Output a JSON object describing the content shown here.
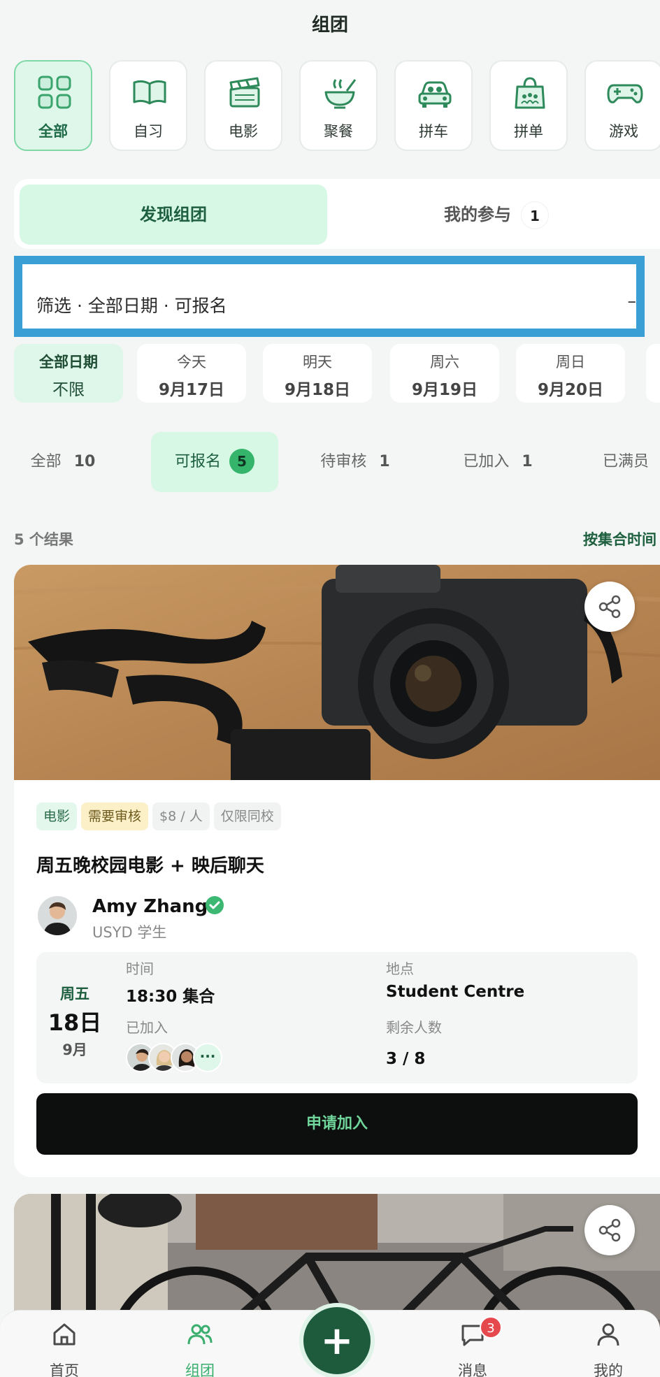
{
  "header": {
    "title": "组团"
  },
  "categories": [
    {
      "label": "全部",
      "icon": "grid-icon",
      "active": true
    },
    {
      "label": "自习",
      "icon": "book-icon"
    },
    {
      "label": "电影",
      "icon": "clapperboard-icon"
    },
    {
      "label": "聚餐",
      "icon": "bowl-icon"
    },
    {
      "label": "拼车",
      "icon": "car-icon"
    },
    {
      "label": "拼单",
      "icon": "shopping-bag-icon"
    },
    {
      "label": "游戏",
      "icon": "gamepad-icon"
    }
  ],
  "segments": {
    "discover": "发现组团",
    "mine": "我的参与",
    "mine_count": "1"
  },
  "filter": {
    "summary": "筛选 · 全部日期 · 可报名",
    "trailing": "–"
  },
  "dates": [
    {
      "top": "全部日期",
      "bottom": "不限",
      "active": true
    },
    {
      "top": "今天",
      "bottom": "9月17日"
    },
    {
      "top": "明天",
      "bottom": "9月18日"
    },
    {
      "top": "周六",
      "bottom": "9月19日"
    },
    {
      "top": "周日",
      "bottom": "9月20日"
    }
  ],
  "status_tabs": [
    {
      "label": "全部",
      "count": "10"
    },
    {
      "label": "可报名",
      "count": "5",
      "active": true
    },
    {
      "label": "待审核",
      "count": "1"
    },
    {
      "label": "已加入",
      "count": "1"
    },
    {
      "label": "已满员",
      "count": ""
    }
  ],
  "results": {
    "count_text": "5 个结果",
    "sort_label": "按集合时间"
  },
  "card": {
    "tags": [
      {
        "text": "电影",
        "style": "green"
      },
      {
        "text": "需要审核",
        "style": "yellow"
      },
      {
        "text": "$8 / 人",
        "style": "neutral"
      },
      {
        "text": "仅限同校",
        "style": "neutral"
      }
    ],
    "title": "周五晚校园电影 + 映后聊天",
    "host_name": "Amy Zhang",
    "host_sub": "USYD 学生",
    "weekday": "周五",
    "day": "18日",
    "month": "9月",
    "time_label": "时间",
    "time_value": "18:30 集合",
    "place_label": "地点",
    "place_value": "Student Centre",
    "joined_label": "已加入",
    "remaining_label": "剩余人数",
    "remaining_value": "3 / 8",
    "more_glyph": "···",
    "join_button": "申请加入"
  },
  "nav": {
    "home": "首页",
    "groups": "组团",
    "create": "+",
    "messages": "消息",
    "messages_badge": "3",
    "me": "我的"
  },
  "colors": {
    "accent": "#3aae6e",
    "accent_dark": "#1e5a3c",
    "highlight": "#3a9fd4"
  }
}
